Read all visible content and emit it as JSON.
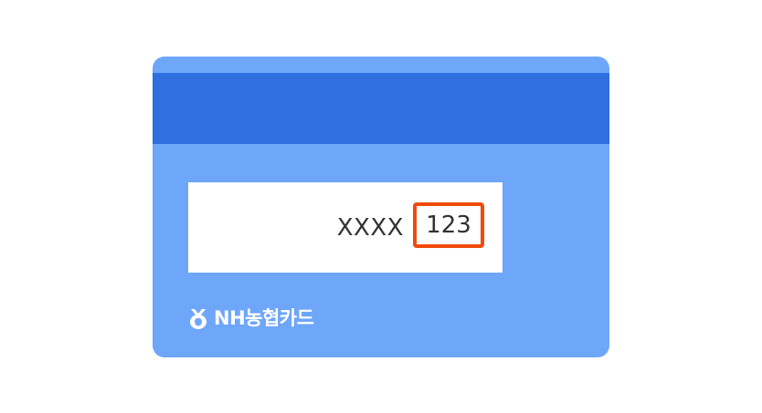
{
  "card": {
    "masked_number": "XXXX",
    "cvc": "123",
    "brand_name": "NH농협카드",
    "brand_icon": "nh-logo-icon",
    "colors": {
      "card_body": "#6ea6fa",
      "magnetic_stripe": "#2f6fdf",
      "signature_panel": "#ffffff",
      "cvc_highlight": "#f04b0c",
      "text": "#333333"
    }
  }
}
